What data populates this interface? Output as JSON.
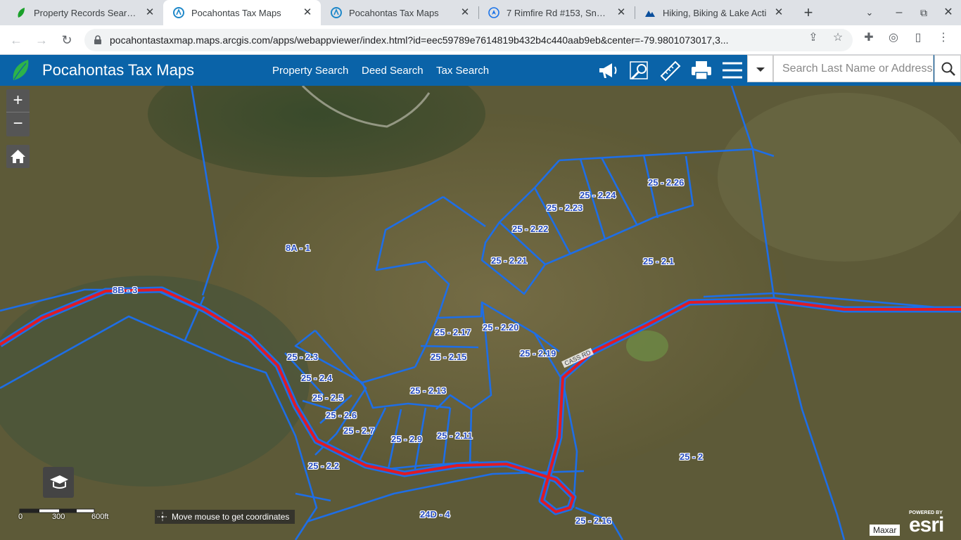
{
  "browser": {
    "tabs": [
      {
        "title": "Property Records Search |",
        "icon": "leaf-icon",
        "active": false
      },
      {
        "title": "Pocahontas Tax Maps",
        "icon": "arcgis-icon",
        "active": true
      },
      {
        "title": "Pocahontas Tax Maps",
        "icon": "arcgis-icon",
        "active": false
      },
      {
        "title": "7 Rimfire Rd #153, Snows",
        "icon": "location-icon",
        "active": false
      },
      {
        "title": "Hiking, Biking & Lake Acti",
        "icon": "mountain-icon",
        "active": false
      }
    ],
    "new_tab_glyph": "+",
    "url": "pocahontastaxmap.maps.arcgis.com/apps/webappviewer/index.html?id=eec59789e7614819b432b4c440aab9eb&center=-79.9801073017,3..."
  },
  "app": {
    "title": "Pocahontas Tax Maps",
    "nav_links": [
      "Property Search",
      "Deed Search",
      "Tax Search"
    ],
    "search_placeholder": "Search Last Name or Address",
    "tools": [
      "megaphone-icon",
      "search-map-icon",
      "measure-icon",
      "print-icon",
      "menu-icon"
    ],
    "colors": {
      "header": "#0a63a8",
      "parcel_line": "#1e6ee6",
      "road": "#e01b24"
    }
  },
  "map": {
    "zoom_in": "+",
    "zoom_out": "−",
    "parcels": [
      "8A - 1",
      "8B - 3",
      "25 - 2.26",
      "25 - 2.24",
      "25 - 2.23",
      "25 - 2.22",
      "25 - 2.21",
      "25 - 2.1",
      "25 - 2.17",
      "25 - 2.20",
      "25 - 2.19",
      "25 - 2.15",
      "25 - 2.3",
      "25 - 2.4",
      "25 - 2.5",
      "25 - 2.13",
      "25 - 2.6",
      "25 - 2.7",
      "25 - 2.9",
      "25 - 2.11",
      "25 - 2.2",
      "25 - 2",
      "24D - 4",
      "25 - 2.16"
    ],
    "road_label": "CASS RD",
    "scale_labels": [
      "0",
      "300",
      "600ft"
    ],
    "coordinates_text": "Move mouse to get coordinates",
    "attribution": "Maxar",
    "esri_powered": "POWERED BY",
    "esri_brand": "esri"
  }
}
